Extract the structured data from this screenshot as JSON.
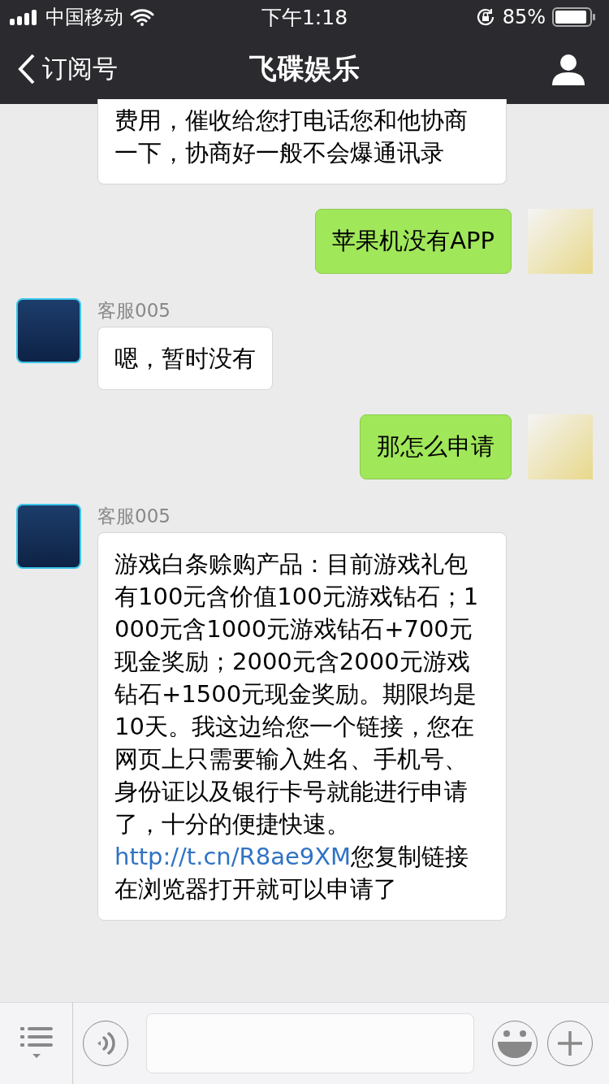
{
  "status_bar": {
    "carrier": "中国移动",
    "time": "下午1:18",
    "battery": "85%"
  },
  "nav": {
    "back": "订阅号",
    "title": "飞碟娱乐"
  },
  "messages": [
    {
      "kind": "incoming",
      "segments": [
        {
          "kind": "text",
          "text": "费用，催收给您打电话您和他协商一下，协商好一般不会爆通讯录"
        }
      ]
    },
    {
      "kind": "outgoing",
      "segments": [
        {
          "kind": "text",
          "text": "苹果机没有APP"
        }
      ]
    },
    {
      "kind": "incoming",
      "sender": "客服005",
      "segments": [
        {
          "kind": "text",
          "text": "嗯，暂时没有"
        }
      ]
    },
    {
      "kind": "outgoing",
      "segments": [
        {
          "kind": "text",
          "text": "那怎么申请"
        }
      ]
    },
    {
      "kind": "incoming",
      "sender": "客服005",
      "segments": [
        {
          "kind": "text",
          "text": "游戏白条赊购产品：目前游戏礼包有100元含价值100元游戏钻石；1000元含1000元游戏钻石+700元现金奖励；2000元含2000元游戏钻石+1500元现金奖励。期限均是10天。我这边给您一个链接，您在网页上只需要输入姓名、手机号、身份证以及银行卡号就能进行申请了，十分的便捷快速。"
        },
        {
          "kind": "link",
          "text": "http://t.cn/R8ae9XM"
        },
        {
          "kind": "text",
          "text": "您复制链接在浏览器打开就可以申请了"
        }
      ]
    }
  ]
}
